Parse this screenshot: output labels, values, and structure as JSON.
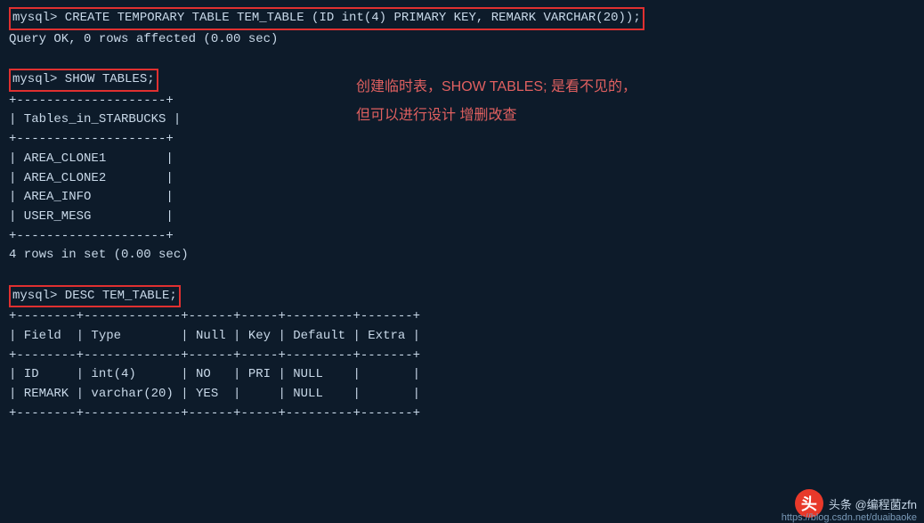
{
  "terminal": {
    "background": "#0d1b2a",
    "lines": [
      {
        "id": "line1",
        "text": "mysql> CREATE TEMPORARY TABLE TEM_TABLE (ID int(4) PRIMARY KEY, REMARK VARCHAR(20));",
        "highlighted": true
      },
      {
        "id": "line2",
        "text": "Query OK, 0 rows affected (0.00 sec)"
      },
      {
        "id": "line3",
        "text": ""
      },
      {
        "id": "line4",
        "text": "mysql> SHOW TABLES;",
        "highlighted": true
      },
      {
        "id": "line5",
        "text": "+--------------------+"
      },
      {
        "id": "line6",
        "text": "| Tables_in_STARBUCKS |"
      },
      {
        "id": "line7",
        "text": "+--------------------+"
      },
      {
        "id": "line8",
        "text": "| AREA_CLONE1        |"
      },
      {
        "id": "line9",
        "text": "| AREA_CLONE2        |"
      },
      {
        "id": "line10",
        "text": "| AREA_INFO          |"
      },
      {
        "id": "line11",
        "text": "| USER_MESG          |"
      },
      {
        "id": "line12",
        "text": "+--------------------+"
      },
      {
        "id": "line13",
        "text": "4 rows in set (0.00 sec)"
      },
      {
        "id": "line14",
        "text": ""
      },
      {
        "id": "line15",
        "text": "mysql> DESC TEM_TABLE;",
        "highlighted": true
      },
      {
        "id": "line16",
        "text": "+--------+-------------+------+-----+---------+-------+"
      },
      {
        "id": "line17",
        "text": "| Field  | Type        | Null | Key | Default | Extra |"
      },
      {
        "id": "line18",
        "text": "+--------+-------------+------+-----+---------+-------+"
      },
      {
        "id": "line19",
        "text": "| ID     | int(4)      | NO   | PRI | NULL    |       |"
      },
      {
        "id": "line20",
        "text": "| REMARK | varchar(20) | YES  |     | NULL    |       |"
      },
      {
        "id": "line21",
        "text": "+--------+-------------+------+-----+---------+-------+"
      }
    ],
    "annotation_line1": "创建临时表，SHOW TABLES; 是看不见的，",
    "annotation_line2": "但可以进行设计 增删改查",
    "watermark_logo": "头",
    "watermark_label": "头条 @编程菌zfn",
    "watermark_url": "https://blog.csdn.net/duaibaoke"
  }
}
